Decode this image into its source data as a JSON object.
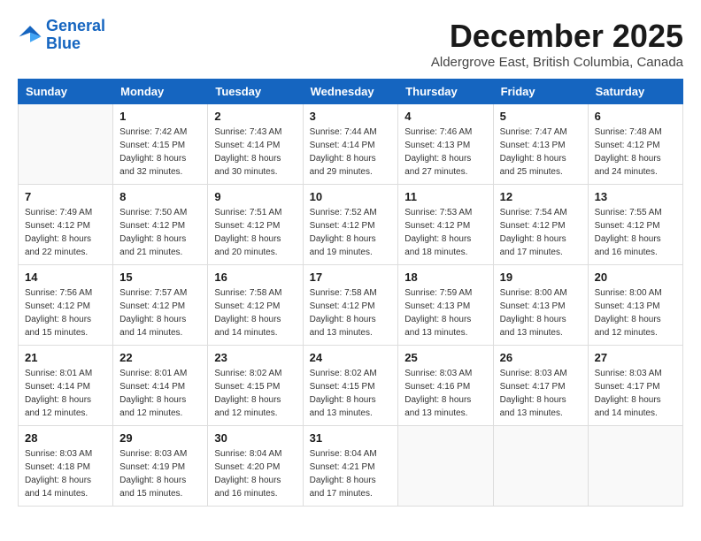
{
  "logo": {
    "line1": "General",
    "line2": "Blue"
  },
  "title": "December 2025",
  "location": "Aldergrove East, British Columbia, Canada",
  "weekdays": [
    "Sunday",
    "Monday",
    "Tuesday",
    "Wednesday",
    "Thursday",
    "Friday",
    "Saturday"
  ],
  "weeks": [
    [
      {
        "day": "",
        "info": ""
      },
      {
        "day": "1",
        "info": "Sunrise: 7:42 AM\nSunset: 4:15 PM\nDaylight: 8 hours\nand 32 minutes."
      },
      {
        "day": "2",
        "info": "Sunrise: 7:43 AM\nSunset: 4:14 PM\nDaylight: 8 hours\nand 30 minutes."
      },
      {
        "day": "3",
        "info": "Sunrise: 7:44 AM\nSunset: 4:14 PM\nDaylight: 8 hours\nand 29 minutes."
      },
      {
        "day": "4",
        "info": "Sunrise: 7:46 AM\nSunset: 4:13 PM\nDaylight: 8 hours\nand 27 minutes."
      },
      {
        "day": "5",
        "info": "Sunrise: 7:47 AM\nSunset: 4:13 PM\nDaylight: 8 hours\nand 25 minutes."
      },
      {
        "day": "6",
        "info": "Sunrise: 7:48 AM\nSunset: 4:12 PM\nDaylight: 8 hours\nand 24 minutes."
      }
    ],
    [
      {
        "day": "7",
        "info": "Sunrise: 7:49 AM\nSunset: 4:12 PM\nDaylight: 8 hours\nand 22 minutes."
      },
      {
        "day": "8",
        "info": "Sunrise: 7:50 AM\nSunset: 4:12 PM\nDaylight: 8 hours\nand 21 minutes."
      },
      {
        "day": "9",
        "info": "Sunrise: 7:51 AM\nSunset: 4:12 PM\nDaylight: 8 hours\nand 20 minutes."
      },
      {
        "day": "10",
        "info": "Sunrise: 7:52 AM\nSunset: 4:12 PM\nDaylight: 8 hours\nand 19 minutes."
      },
      {
        "day": "11",
        "info": "Sunrise: 7:53 AM\nSunset: 4:12 PM\nDaylight: 8 hours\nand 18 minutes."
      },
      {
        "day": "12",
        "info": "Sunrise: 7:54 AM\nSunset: 4:12 PM\nDaylight: 8 hours\nand 17 minutes."
      },
      {
        "day": "13",
        "info": "Sunrise: 7:55 AM\nSunset: 4:12 PM\nDaylight: 8 hours\nand 16 minutes."
      }
    ],
    [
      {
        "day": "14",
        "info": "Sunrise: 7:56 AM\nSunset: 4:12 PM\nDaylight: 8 hours\nand 15 minutes."
      },
      {
        "day": "15",
        "info": "Sunrise: 7:57 AM\nSunset: 4:12 PM\nDaylight: 8 hours\nand 14 minutes."
      },
      {
        "day": "16",
        "info": "Sunrise: 7:58 AM\nSunset: 4:12 PM\nDaylight: 8 hours\nand 14 minutes."
      },
      {
        "day": "17",
        "info": "Sunrise: 7:58 AM\nSunset: 4:12 PM\nDaylight: 8 hours\nand 13 minutes."
      },
      {
        "day": "18",
        "info": "Sunrise: 7:59 AM\nSunset: 4:13 PM\nDaylight: 8 hours\nand 13 minutes."
      },
      {
        "day": "19",
        "info": "Sunrise: 8:00 AM\nSunset: 4:13 PM\nDaylight: 8 hours\nand 13 minutes."
      },
      {
        "day": "20",
        "info": "Sunrise: 8:00 AM\nSunset: 4:13 PM\nDaylight: 8 hours\nand 12 minutes."
      }
    ],
    [
      {
        "day": "21",
        "info": "Sunrise: 8:01 AM\nSunset: 4:14 PM\nDaylight: 8 hours\nand 12 minutes."
      },
      {
        "day": "22",
        "info": "Sunrise: 8:01 AM\nSunset: 4:14 PM\nDaylight: 8 hours\nand 12 minutes."
      },
      {
        "day": "23",
        "info": "Sunrise: 8:02 AM\nSunset: 4:15 PM\nDaylight: 8 hours\nand 12 minutes."
      },
      {
        "day": "24",
        "info": "Sunrise: 8:02 AM\nSunset: 4:15 PM\nDaylight: 8 hours\nand 13 minutes."
      },
      {
        "day": "25",
        "info": "Sunrise: 8:03 AM\nSunset: 4:16 PM\nDaylight: 8 hours\nand 13 minutes."
      },
      {
        "day": "26",
        "info": "Sunrise: 8:03 AM\nSunset: 4:17 PM\nDaylight: 8 hours\nand 13 minutes."
      },
      {
        "day": "27",
        "info": "Sunrise: 8:03 AM\nSunset: 4:17 PM\nDaylight: 8 hours\nand 14 minutes."
      }
    ],
    [
      {
        "day": "28",
        "info": "Sunrise: 8:03 AM\nSunset: 4:18 PM\nDaylight: 8 hours\nand 14 minutes."
      },
      {
        "day": "29",
        "info": "Sunrise: 8:03 AM\nSunset: 4:19 PM\nDaylight: 8 hours\nand 15 minutes."
      },
      {
        "day": "30",
        "info": "Sunrise: 8:04 AM\nSunset: 4:20 PM\nDaylight: 8 hours\nand 16 minutes."
      },
      {
        "day": "31",
        "info": "Sunrise: 8:04 AM\nSunset: 4:21 PM\nDaylight: 8 hours\nand 17 minutes."
      },
      {
        "day": "",
        "info": ""
      },
      {
        "day": "",
        "info": ""
      },
      {
        "day": "",
        "info": ""
      }
    ]
  ]
}
